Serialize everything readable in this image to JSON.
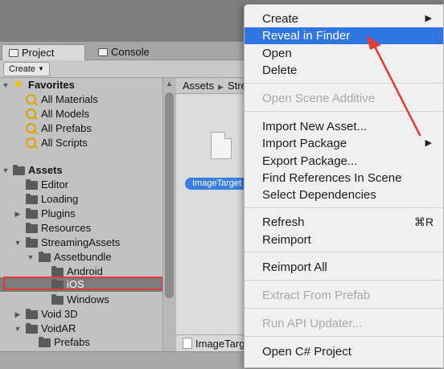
{
  "tabs": [
    {
      "label": "Project",
      "icon": "project-icon"
    },
    {
      "label": "Console",
      "icon": "console-icon"
    }
  ],
  "toolbar": {
    "create_label": "Create"
  },
  "tree": {
    "favorites_label": "Favorites",
    "favorites": [
      "All Materials",
      "All Models",
      "All Prefabs",
      "All Scripts"
    ],
    "assets_label": "Assets",
    "items": [
      {
        "label": "Editor"
      },
      {
        "label": "Loading"
      },
      {
        "label": "Plugins"
      },
      {
        "label": "Resources"
      },
      {
        "label": "StreamingAssets"
      },
      {
        "label": "Assetbundle"
      },
      {
        "label": "Android"
      },
      {
        "label": "iOS",
        "selected": true
      },
      {
        "label": "Windows"
      },
      {
        "label": "Void 3D"
      },
      {
        "label": "VoidAR"
      },
      {
        "label": "Prefabs"
      }
    ]
  },
  "breadcrumb": {
    "root": "Assets",
    "next": "Stre"
  },
  "asset_grid": {
    "selected_file": "ImageTarget",
    "bottom_file": "ImageTarg"
  },
  "context_menu": {
    "items": [
      {
        "label": "Create",
        "submenu": true
      },
      {
        "label": "Reveal in Finder",
        "highlighted": true
      },
      {
        "label": "Open"
      },
      {
        "label": "Delete"
      },
      {
        "label": "Open Scene Additive",
        "disabled": true
      },
      {
        "label": "Import New Asset..."
      },
      {
        "label": "Import Package",
        "submenu": true
      },
      {
        "label": "Export Package..."
      },
      {
        "label": "Find References In Scene"
      },
      {
        "label": "Select Dependencies"
      },
      {
        "label": "Refresh",
        "shortcut": "⌘R"
      },
      {
        "label": "Reimport"
      },
      {
        "label": "Reimport All"
      },
      {
        "label": "Extract From Prefab",
        "disabled": true
      },
      {
        "label": "Run API Updater...",
        "disabled": true
      },
      {
        "label": "Open C# Project"
      }
    ]
  },
  "colors": {
    "highlight": "#2f76e3",
    "annotation": "#e53935"
  }
}
